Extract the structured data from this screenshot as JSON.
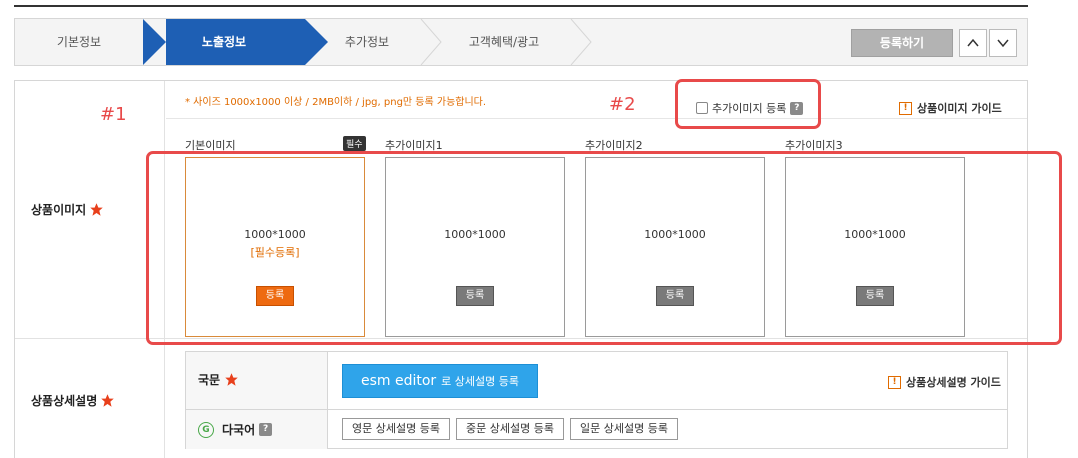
{
  "steps": [
    "기본정보",
    "노출정보",
    "추가정보",
    "고객혜택/광고"
  ],
  "toolbar": {
    "register_label": "등록하기"
  },
  "image_section": {
    "label": "상품이미지",
    "notice": "* 사이즈 1000x1000 이상 / 2MB이하 / jpg, png만 등록 가능합니다.",
    "add_image_checkbox": "추가이미지 등록",
    "help_badge": "?",
    "guide": "상품이미지 가이드",
    "warn_glyph": "!",
    "required_badge": "필수",
    "images": [
      {
        "title": "기본이미지",
        "size": "1000*1000",
        "required_text": "[필수등록]",
        "button": "등록"
      },
      {
        "title": "추가이미지1",
        "size": "1000*1000",
        "button": "등록"
      },
      {
        "title": "추가이미지2",
        "size": "1000*1000",
        "button": "등록"
      },
      {
        "title": "추가이미지3",
        "size": "1000*1000",
        "button": "등록"
      }
    ]
  },
  "detail_section": {
    "label": "상품상세설명",
    "korean_label": "국문",
    "multilang_label": "다국어",
    "g_badge": "G",
    "help_badge": "?",
    "esm_strong": "esm editor",
    "esm_rest": "로 상세설명 등록",
    "guide": "상품상세설명 가이드",
    "warn_glyph": "!",
    "lang_buttons": [
      "영문 상세설명 등록",
      "중문 상세설명 등록",
      "일문 상세설명 등록"
    ]
  },
  "annotations": {
    "a1": "#1",
    "a2": "#2"
  },
  "colors": {
    "accent": "#1e5fb4",
    "annotation": "#e84a4a",
    "star": "#e8401c",
    "notice": "#e06b00"
  }
}
